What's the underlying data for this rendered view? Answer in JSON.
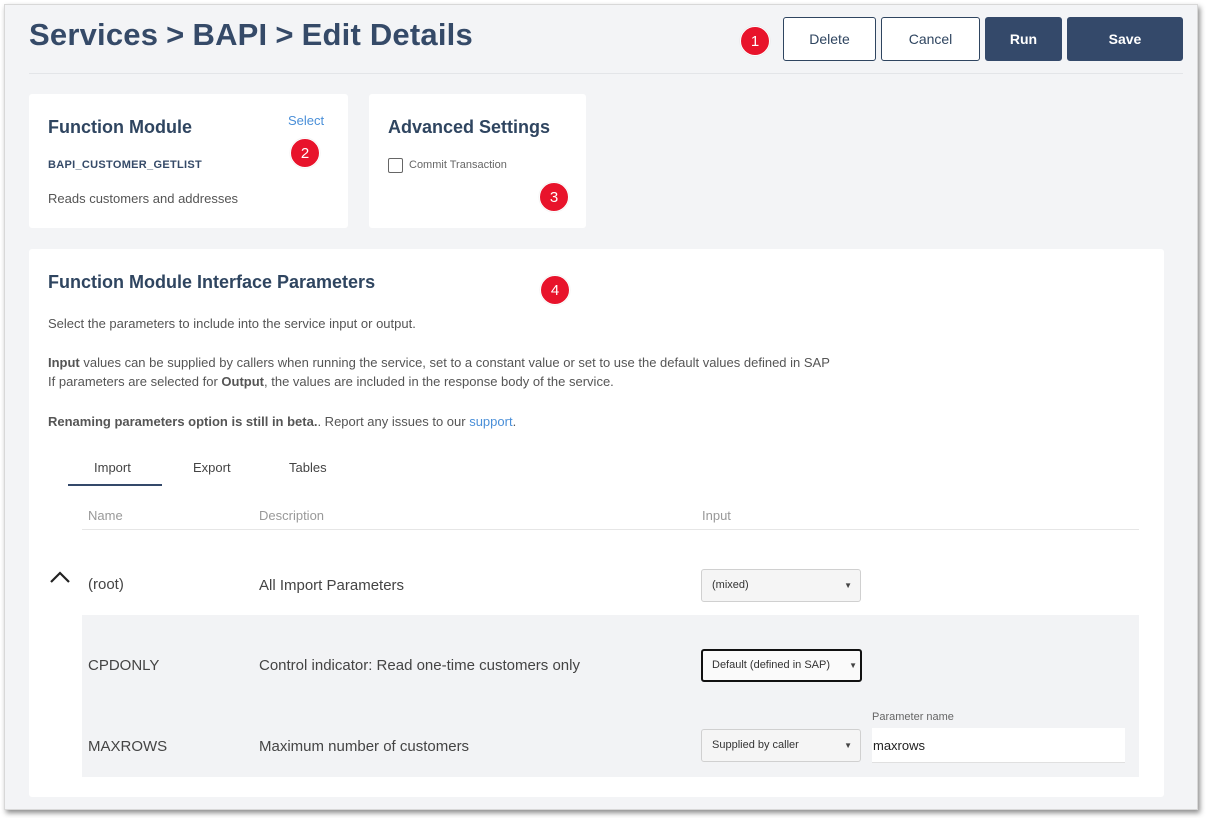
{
  "header": {
    "breadcrumb": [
      "Services",
      "BAPI",
      "Edit Details"
    ],
    "separator": ">",
    "badge": "1",
    "buttons": {
      "delete": "Delete",
      "cancel": "Cancel",
      "run": "Run",
      "save": "Save"
    }
  },
  "function_module": {
    "title": "Function Module",
    "select_label": "Select",
    "name": "BAPI_CUSTOMER_GETLIST",
    "description": "Reads customers and addresses",
    "badge": "2"
  },
  "advanced_settings": {
    "title": "Advanced Settings",
    "commit_label": "Commit Transaction",
    "commit_checked": false,
    "badge": "3"
  },
  "interface": {
    "title": "Function Module Interface Parameters",
    "badge": "4",
    "intro": "Select the parameters to include into the service input or output.",
    "input_bold": "Input",
    "input_text": " values can be supplied by callers when running the service, set to a constant value or set to use the default values defined in SAP",
    "output_pre": "If parameters are selected for ",
    "output_bold": "Output",
    "output_post": ", the values are included in the response body of the service.",
    "beta_bold": "Renaming parameters option is still in beta.",
    "beta_text": ". Report any issues to our ",
    "support_link": "support",
    "beta_end": ".",
    "tabs": [
      "Import",
      "Export",
      "Tables"
    ],
    "active_tab": "Import",
    "columns": {
      "name": "Name",
      "description": "Description",
      "input": "Input"
    },
    "root": {
      "name": "(root)",
      "description": "All Import Parameters",
      "input": "(mixed)"
    },
    "rows": [
      {
        "name": "CPDONLY",
        "description": "Control indicator: Read one-time customers only",
        "input": "Default (defined in SAP)"
      },
      {
        "name": "MAXROWS",
        "description": "Maximum number of customers",
        "input": "Supplied by caller",
        "param_label": "Parameter name",
        "param_value": "maxrows"
      }
    ]
  }
}
